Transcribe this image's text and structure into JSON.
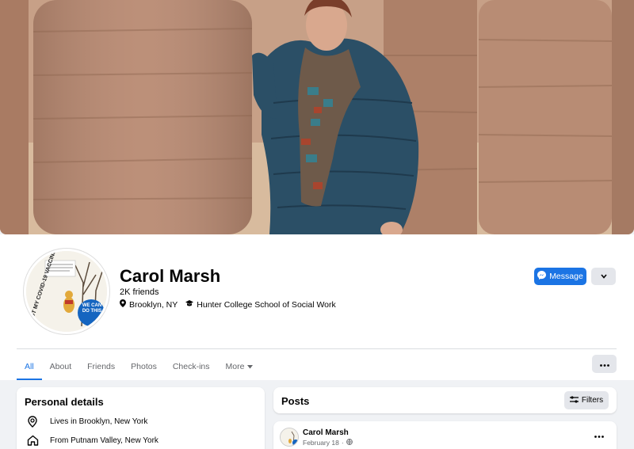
{
  "profile": {
    "name": "Carol Marsh",
    "friends": "2K friends",
    "location": "Brooklyn, NY",
    "school": "Hunter College School of Social Work",
    "avatar_text": {
      "line1": "I GOT MY COVID-19 VACCINE",
      "badge": "WE CAN DO THIS",
      "quote": "You're braver than you believe, stronger than you seem, smarter than you think."
    }
  },
  "actions": {
    "message_label": "Message",
    "caret_icon": "chevron-down-icon"
  },
  "tabs": [
    {
      "label": "All"
    },
    {
      "label": "About"
    },
    {
      "label": "Friends"
    },
    {
      "label": "Photos"
    },
    {
      "label": "Check-ins"
    },
    {
      "label": "More"
    }
  ],
  "personal_details": {
    "title": "Personal details",
    "rows": [
      {
        "icon": "location-pin-icon",
        "text": "Lives in Brooklyn, New York"
      },
      {
        "icon": "home-icon",
        "text": "From Putnam Valley, New York"
      }
    ]
  },
  "posts": {
    "title": "Posts",
    "filters_label": "Filters",
    "first_post": {
      "author": "Carol Marsh",
      "date": "February 18",
      "separator": "·",
      "privacy_icon": "globe-icon"
    }
  },
  "colors": {
    "accent": "#1b74e4",
    "background": "#f0f2f5",
    "button_gray": "#e4e6eb",
    "secondary_text": "#65676b"
  }
}
